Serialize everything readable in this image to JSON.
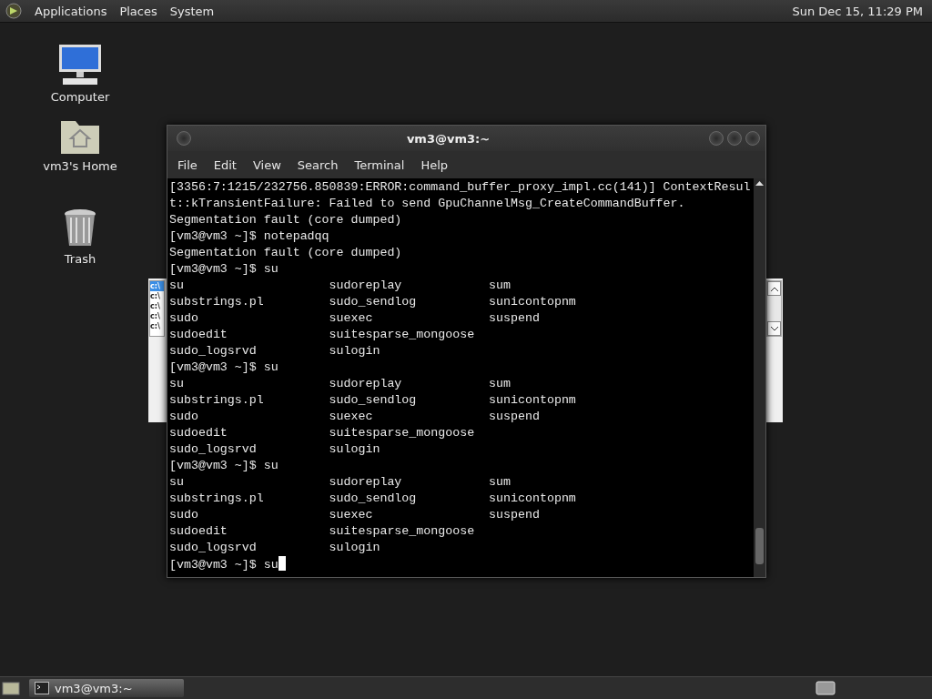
{
  "top_panel": {
    "menus": [
      "Applications",
      "Places",
      "System"
    ],
    "clock": "Sun Dec 15, 11:29 PM"
  },
  "desktop_icons": [
    {
      "kind": "computer",
      "label": "Computer"
    },
    {
      "kind": "home",
      "label": "vm3's Home"
    },
    {
      "kind": "trash",
      "label": "Trash"
    }
  ],
  "background_window": {
    "list_items": [
      {
        "text": "c:\\",
        "selected": true
      },
      {
        "text": "c:\\",
        "selected": false
      },
      {
        "text": "c:\\",
        "selected": false
      },
      {
        "text": "c:\\",
        "selected": false
      },
      {
        "text": "c:\\",
        "selected": false
      }
    ]
  },
  "terminal": {
    "title": "vm3@vm3:~",
    "menu": [
      "File",
      "Edit",
      "View",
      "Search",
      "Terminal",
      "Help"
    ],
    "lines": [
      {
        "kind": "text",
        "text": "[3356:7:1215/232756.850839:ERROR:command_buffer_proxy_impl.cc(141)] ContextResul"
      },
      {
        "kind": "text",
        "text": "t::kTransientFailure: Failed to send GpuChannelMsg_CreateCommandBuffer."
      },
      {
        "kind": "text",
        "text": "Segmentation fault (core dumped)"
      },
      {
        "kind": "text",
        "text": "[vm3@vm3 ~]$ notepadqq"
      },
      {
        "kind": "text",
        "text": "Segmentation fault (core dumped)"
      },
      {
        "kind": "text",
        "text": "[vm3@vm3 ~]$ su"
      },
      {
        "kind": "columns",
        "cells": [
          "su",
          "sudoreplay",
          "sum"
        ]
      },
      {
        "kind": "columns",
        "cells": [
          "substrings.pl",
          "sudo_sendlog",
          "sunicontopnm"
        ]
      },
      {
        "kind": "columns",
        "cells": [
          "sudo",
          "suexec",
          "suspend"
        ]
      },
      {
        "kind": "columns",
        "cells": [
          "sudoedit",
          "suitesparse_mongoose"
        ]
      },
      {
        "kind": "columns",
        "cells": [
          "sudo_logsrvd",
          "sulogin"
        ]
      },
      {
        "kind": "text",
        "text": "[vm3@vm3 ~]$ su"
      },
      {
        "kind": "columns",
        "cells": [
          "su",
          "sudoreplay",
          "sum"
        ]
      },
      {
        "kind": "columns",
        "cells": [
          "substrings.pl",
          "sudo_sendlog",
          "sunicontopnm"
        ]
      },
      {
        "kind": "columns",
        "cells": [
          "sudo",
          "suexec",
          "suspend"
        ]
      },
      {
        "kind": "columns",
        "cells": [
          "sudoedit",
          "suitesparse_mongoose"
        ]
      },
      {
        "kind": "columns",
        "cells": [
          "sudo_logsrvd",
          "sulogin"
        ]
      },
      {
        "kind": "text",
        "text": "[vm3@vm3 ~]$ su"
      },
      {
        "kind": "columns",
        "cells": [
          "su",
          "sudoreplay",
          "sum"
        ]
      },
      {
        "kind": "columns",
        "cells": [
          "substrings.pl",
          "sudo_sendlog",
          "sunicontopnm"
        ]
      },
      {
        "kind": "columns",
        "cells": [
          "sudo",
          "suexec",
          "suspend"
        ]
      },
      {
        "kind": "columns",
        "cells": [
          "sudoedit",
          "suitesparse_mongoose"
        ]
      },
      {
        "kind": "columns",
        "cells": [
          "sudo_logsrvd",
          "sulogin"
        ]
      },
      {
        "kind": "prompt",
        "text": "[vm3@vm3 ~]$ su"
      }
    ]
  },
  "taskbar": {
    "tasks": [
      {
        "label": "vm3@vm3:~",
        "selected": true
      }
    ]
  }
}
